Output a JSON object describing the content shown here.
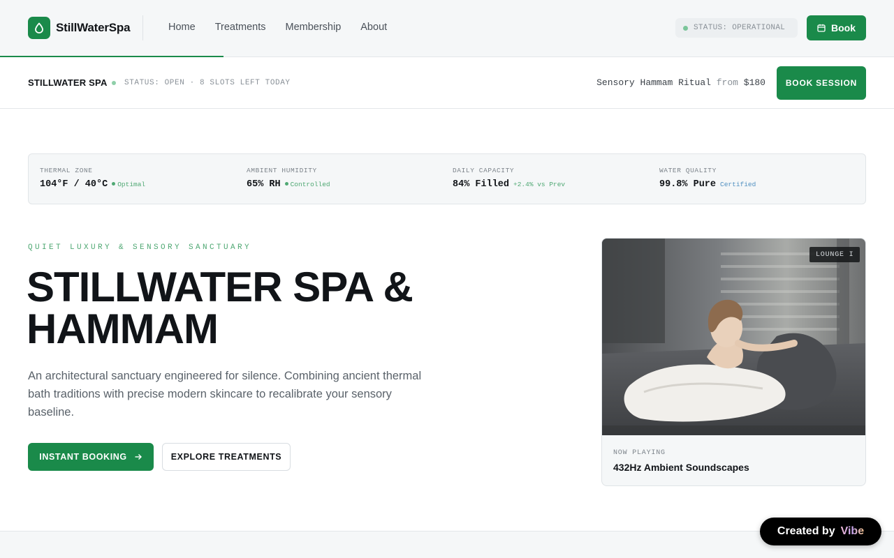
{
  "nav": {
    "brand": "StillWaterSpa",
    "links": [
      "Home",
      "Treatments",
      "Membership",
      "About"
    ],
    "status": "STATUS: OPERATIONAL",
    "book_label": "Book"
  },
  "subbar": {
    "brand": "STILLWATER SPA",
    "status": "STATUS: OPEN · 8 SLOTS LEFT TODAY",
    "ritual": "Sensory Hammam Ritual",
    "from_label": "from",
    "price": "$180",
    "book_label": "BOOK SESSION"
  },
  "stats": [
    {
      "label": "THERMAL ZONE",
      "value": "104°F / 40°C",
      "note": "Optimal"
    },
    {
      "label": "AMBIENT HUMIDITY",
      "value": "65% RH",
      "note": "Controlled"
    },
    {
      "label": "DAILY CAPACITY",
      "value": "84% Filled",
      "note": "+2.4% vs Prev"
    },
    {
      "label": "WATER QUALITY",
      "value": "99.8% Pure",
      "note": "Certified"
    }
  ],
  "hero": {
    "eyebrow": "QUIET LUXURY & SENSORY SANCTUARY",
    "title_line1": "STILLWATER SPA &",
    "title_line2": "HAMMAM",
    "description": "An architectural sanctuary engineered for silence. Combining ancient thermal bath traditions with precise modern skincare to recalibrate your sensory baseline.",
    "primary_cta": "INSTANT BOOKING",
    "secondary_cta": "EXPLORE TREATMENTS"
  },
  "card": {
    "tag": "LOUNGE I",
    "now_label": "NOW PLAYING",
    "now_title": "432Hz Ambient Soundscapes"
  },
  "badge": {
    "prefix": "Created by",
    "brand": "Vibe"
  },
  "colors": {
    "accent": "#1a8a4a",
    "accent_light": "#4fa873",
    "info": "#4f8fc0"
  },
  "icons": {
    "logo": "droplet-icon",
    "book": "calendar-icon",
    "cta": "arrow-right-icon"
  }
}
